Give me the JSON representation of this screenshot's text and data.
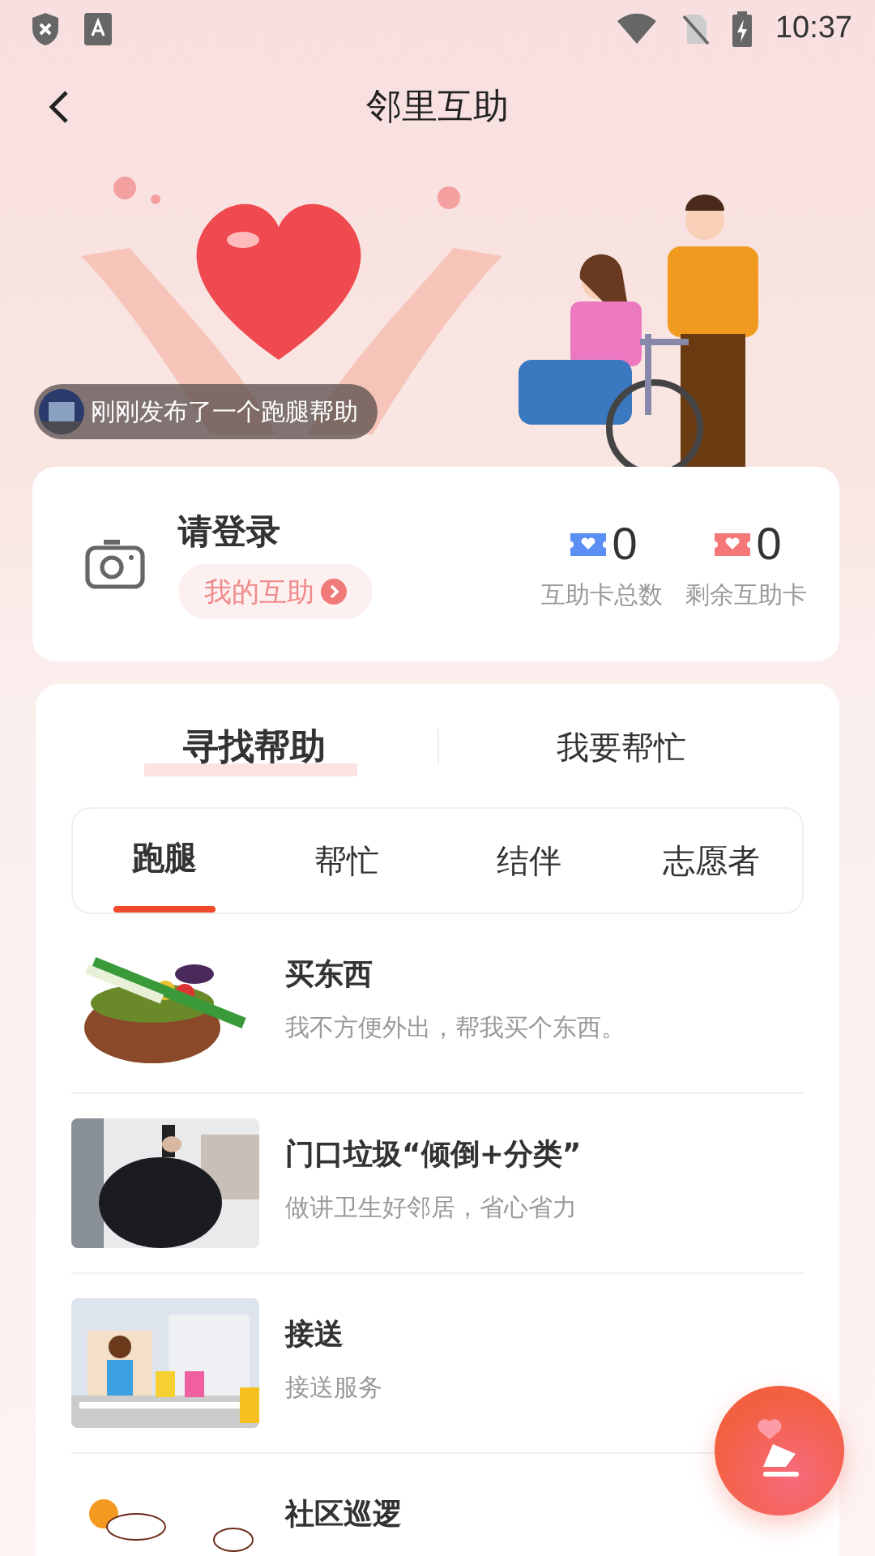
{
  "status_bar": {
    "time": "10:37"
  },
  "header": {
    "title": "邻里互助"
  },
  "toast": {
    "text": "刚刚发布了一个跑腿帮助"
  },
  "profile": {
    "name": "请登录",
    "link": "我的互助",
    "stats": [
      {
        "kind": "total",
        "value": "0",
        "label": "互助卡总数"
      },
      {
        "kind": "remaining",
        "value": "0",
        "label": "剩余互助卡"
      }
    ]
  },
  "main_tabs": [
    {
      "label": "寻找帮助",
      "selected": true
    },
    {
      "label": "我要帮忙",
      "selected": false
    }
  ],
  "sub_tabs": [
    {
      "label": "跑腿",
      "selected": true
    },
    {
      "label": "帮忙",
      "selected": false
    },
    {
      "label": "结伴",
      "selected": false
    },
    {
      "label": "志愿者",
      "selected": false
    }
  ],
  "items": [
    {
      "title": "买东西",
      "subtitle": "我不方便外出，帮我买个东西。"
    },
    {
      "title": "门口垃圾“倾倒+分类”",
      "subtitle": "做讲卫生好邻居，省心省力"
    },
    {
      "title": "接送",
      "subtitle": "接送服务"
    },
    {
      "title": "社区巡逻"
    }
  ]
}
